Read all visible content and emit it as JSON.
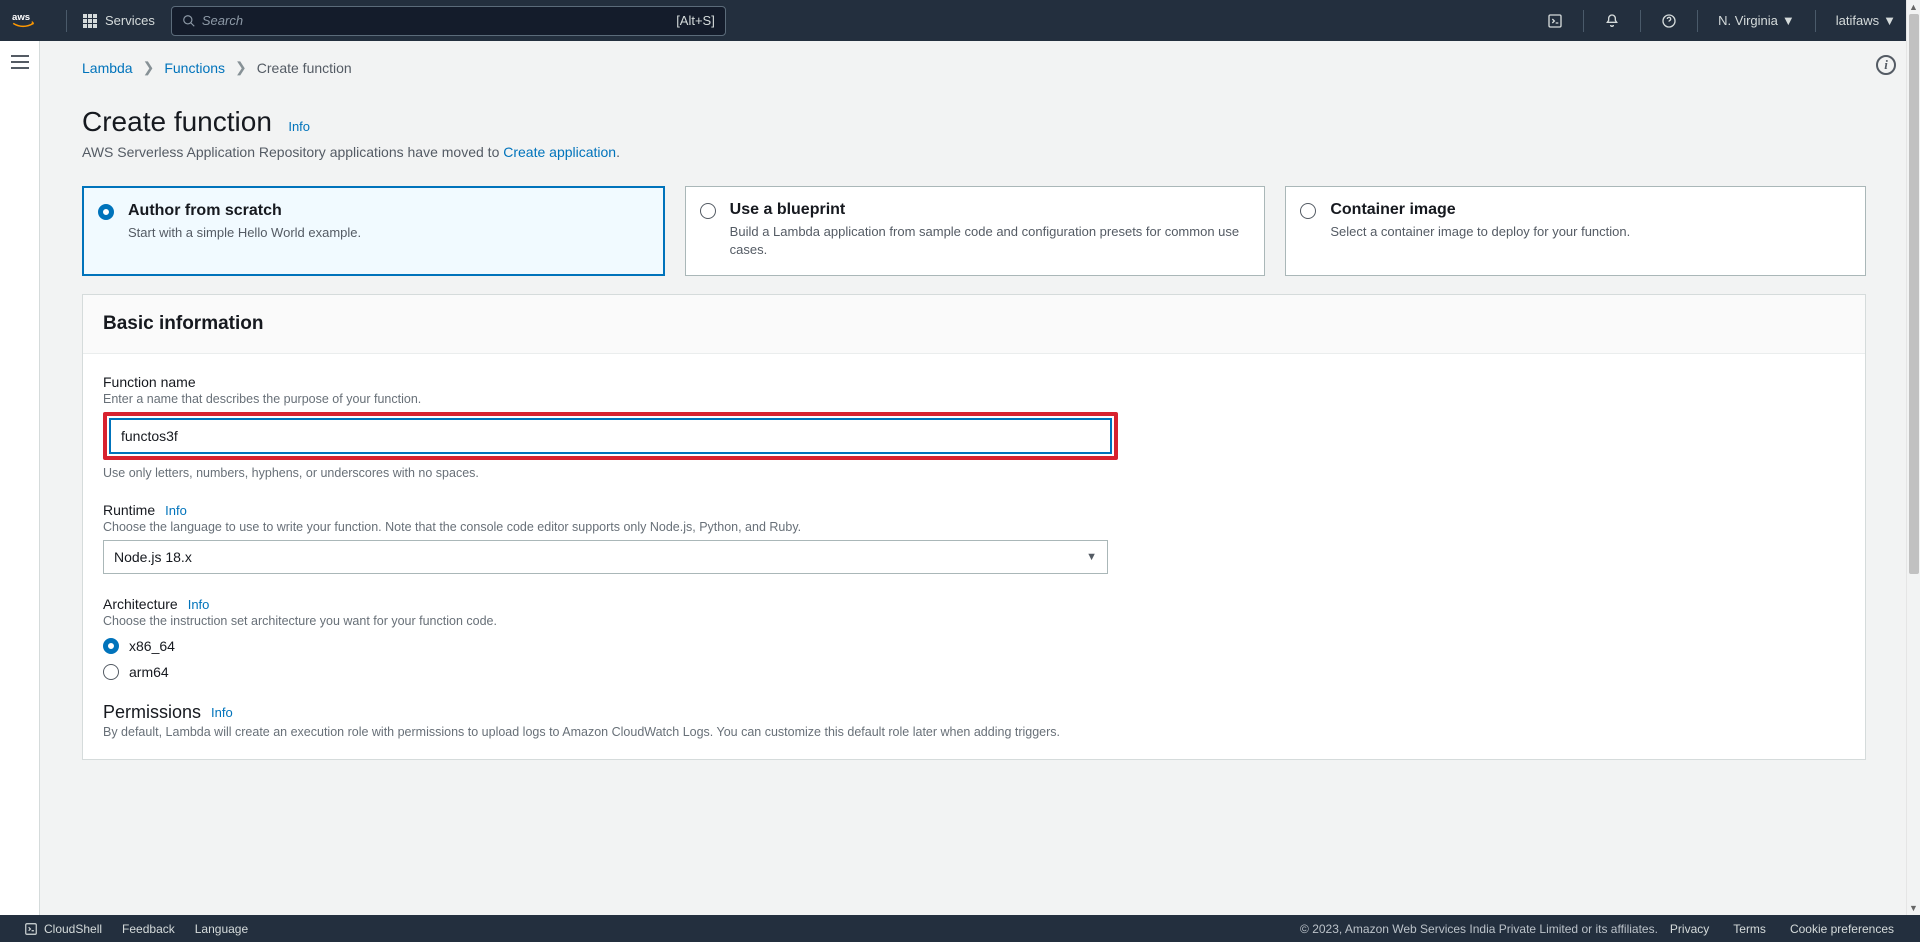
{
  "topnav": {
    "services_label": "Services",
    "search_placeholder": "Search",
    "search_hint": "[Alt+S]",
    "region": "N. Virginia",
    "account": "latifaws"
  },
  "breadcrumb": {
    "root": "Lambda",
    "functions": "Functions",
    "current": "Create function"
  },
  "header": {
    "title": "Create function",
    "info": "Info",
    "subtitle_prefix": "AWS Serverless Application Repository applications have moved to ",
    "subtitle_link": "Create application",
    "subtitle_suffix": "."
  },
  "options": [
    {
      "title": "Author from scratch",
      "desc": "Start with a simple Hello World example.",
      "selected": true
    },
    {
      "title": "Use a blueprint",
      "desc": "Build a Lambda application from sample code and configuration presets for common use cases.",
      "selected": false
    },
    {
      "title": "Container image",
      "desc": "Select a container image to deploy for your function.",
      "selected": false
    }
  ],
  "panel": {
    "title": "Basic information"
  },
  "fn": {
    "label": "Function name",
    "help": "Enter a name that describes the purpose of your function.",
    "value": "functos3f",
    "constraint": "Use only letters, numbers, hyphens, or underscores with no spaces."
  },
  "runtime": {
    "label": "Runtime",
    "info": "Info",
    "help": "Choose the language to use to write your function. Note that the console code editor supports only Node.js, Python, and Ruby.",
    "value": "Node.js 18.x"
  },
  "arch": {
    "label": "Architecture",
    "info": "Info",
    "help": "Choose the instruction set architecture you want for your function code.",
    "opt1": "x86_64",
    "opt2": "arm64"
  },
  "perm": {
    "label": "Permissions",
    "info": "Info",
    "help": "By default, Lambda will create an execution role with permissions to upload logs to Amazon CloudWatch Logs. You can customize this default role later when adding triggers."
  },
  "footer": {
    "cloudshell": "CloudShell",
    "feedback": "Feedback",
    "language": "Language",
    "copyright": "© 2023, Amazon Web Services India Private Limited or its affiliates.",
    "privacy": "Privacy",
    "terms": "Terms",
    "cookie": "Cookie preferences"
  }
}
